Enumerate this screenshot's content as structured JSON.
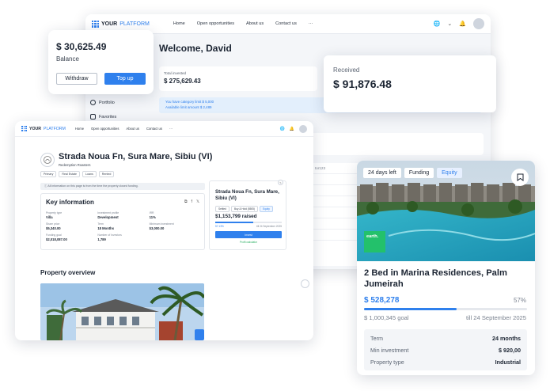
{
  "dashboard": {
    "brand": {
      "your": "YOUR",
      "platform": "PLATFORM"
    },
    "nav": [
      "Home",
      "Open opportunities",
      "About us",
      "Contact us",
      "···"
    ],
    "globe": "🌐",
    "chev": "⌄",
    "bell": "🔔",
    "welcome": "Welcome, David",
    "total_invested_label": "Total invested",
    "total_invested_value": "$ 275,629.43",
    "info_line1": "You have category limit $ 5,000",
    "info_line2": "Available limit amount $ 2,489",
    "sidebar": [
      {
        "label": "Portfolio"
      },
      {
        "label": "Favorites"
      }
    ],
    "table_cell": "tor123"
  },
  "received": {
    "label": "Received",
    "value": "$ 91,876.48"
  },
  "balance": {
    "amount": "$ 30,625.49",
    "label": "Balance",
    "withdraw": "Withdraw",
    "topup": "Top up"
  },
  "property": {
    "brand": {
      "your": "YOUR",
      "platform": "PLATFORM"
    },
    "nav": [
      "Home",
      "Open opportunities",
      "About us",
      "Contact us",
      "···"
    ],
    "title": "Strada Noua Fn, Sura Mare, Sibiu (VI)",
    "subtitle": "Redemption Roasters",
    "tags": [
      "Primary",
      "Real Estate",
      "Loans",
      "Rented"
    ],
    "info": "All information on this page is from the time the property closed funding.",
    "key_info": {
      "title": "Key information",
      "items": [
        {
          "k": "Property type",
          "v": "Villa"
        },
        {
          "k": "Investment profile",
          "v": "Development"
        },
        {
          "k": "IRR",
          "v": "11%"
        },
        {
          "k": "Share price",
          "v": "$5,340.00"
        },
        {
          "k": "Term",
          "v": "18 Months"
        },
        {
          "k": "Minimum investment",
          "v": "$3,000.00"
        },
        {
          "k": "Funding goal",
          "v": "$2,018,087.00"
        },
        {
          "k": "Number of Investors",
          "v": "1,789"
        }
      ]
    },
    "funding": {
      "title": "Strada Noua Fn, Sura Mare, Sibiu (VI)",
      "badges": [
        "Settled",
        "Buy & Hold (5505)",
        "Equity"
      ],
      "raised": "$1,153,799 raised",
      "percent_text": "57.13%",
      "date": "till 24 September 2025",
      "progress": 0.57,
      "button": "Invest",
      "calc": "Profit calculator"
    },
    "overview": "Property overview"
  },
  "listing": {
    "badges": [
      "24 days left",
      "Funding",
      "Equity"
    ],
    "earth_logo": "earth.",
    "title": "2 Bed in Marina Residences, Palm Jumeirah",
    "raised": "$ 528,278",
    "percent": "57%",
    "progress": 0.57,
    "goal": "$ 1,000,345 goal",
    "until": "till 24 September 2025",
    "facts": [
      {
        "k": "Term",
        "v": "24 months"
      },
      {
        "k": "Min investment",
        "v": "$ 920,00"
      },
      {
        "k": "Property type",
        "v": "Industrial"
      }
    ]
  },
  "colors": {
    "accent": "#2f80ed",
    "green": "#23c16b",
    "dark": "#1c2533"
  },
  "icons": [
    "globe-icon",
    "bell-icon",
    "avatar",
    "bookmark-icon",
    "portfolio-icon",
    "favorites-icon",
    "info-icon",
    "share-icon",
    "facebook-icon",
    "x-icon"
  ]
}
